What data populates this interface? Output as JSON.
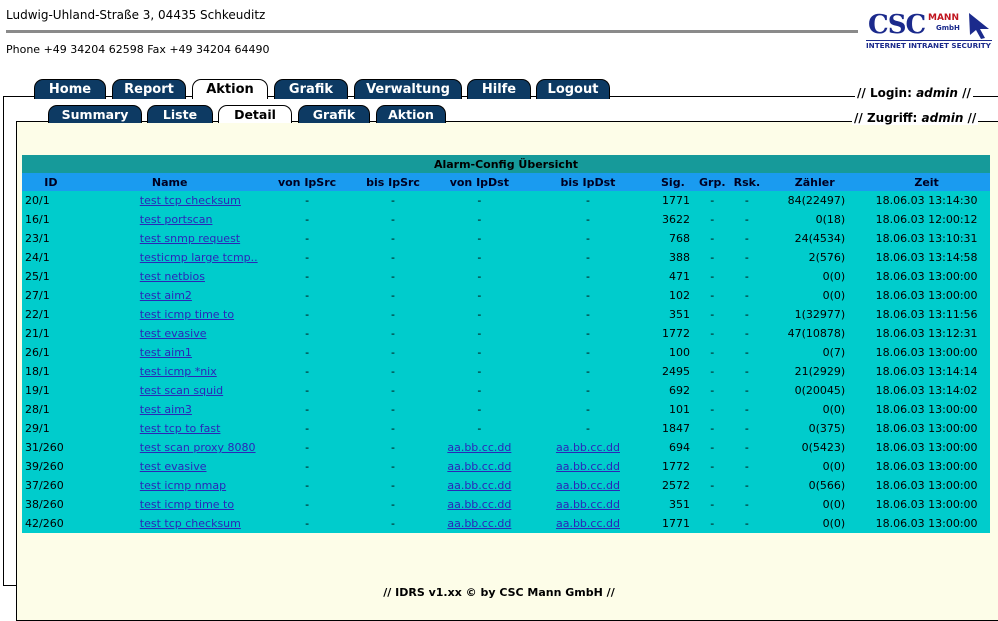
{
  "header": {
    "address": "Ludwig-Uhland-Straße 3, 04435 Schkeuditz",
    "phone": "Phone +49 34204 62598 Fax +49 34204 64490",
    "logo": {
      "csc": "CSC",
      "mann": "MANN",
      "gmbh": "GmbH",
      "tagline": "INTERNET INTRANET SECURITY"
    }
  },
  "main_tabs": [
    {
      "label": "Home"
    },
    {
      "label": "Report"
    },
    {
      "label": "Aktion"
    },
    {
      "label": "Grafik"
    },
    {
      "label": "Verwaltung"
    },
    {
      "label": "Hilfe"
    },
    {
      "label": "Logout"
    }
  ],
  "sub_tabs": [
    {
      "label": "Summary"
    },
    {
      "label": "Liste"
    },
    {
      "label": "Detail"
    },
    {
      "label": "Grafik"
    },
    {
      "label": "Aktion"
    }
  ],
  "login": {
    "prefix": "// Login: ",
    "user": "admin",
    "suffix": " //"
  },
  "zugriff": {
    "prefix": "// Zugriff: ",
    "user": "admin",
    "suffix": " //"
  },
  "table": {
    "caption": "Alarm-Config Übersicht",
    "columns": [
      "ID",
      "Name",
      "von IpSrc",
      "bis IpSrc",
      "von IpDst",
      "bis IpDst",
      "Sig.",
      "Grp.",
      "Rsk.",
      "Zähler",
      "Zeit"
    ],
    "rows": [
      [
        "20/1",
        "test tcp checksum",
        "-",
        "-",
        "-",
        "-",
        "1771",
        "-",
        "-",
        "84(22497)",
        "18.06.03 13:14:30"
      ],
      [
        "16/1",
        "test portscan",
        "-",
        "-",
        "-",
        "-",
        "3622",
        "-",
        "-",
        "0(18)",
        "18.06.03 12:00:12"
      ],
      [
        "23/1",
        "test snmp request",
        "-",
        "-",
        "-",
        "-",
        "768",
        "-",
        "-",
        "24(4534)",
        "18.06.03 13:10:31"
      ],
      [
        "24/1",
        "testicmp large tcmp..",
        "-",
        "-",
        "-",
        "-",
        "388",
        "-",
        "-",
        "2(576)",
        "18.06.03 13:14:58"
      ],
      [
        "25/1",
        "test netbios",
        "-",
        "-",
        "-",
        "-",
        "471",
        "-",
        "-",
        "0(0)",
        "18.06.03 13:00:00"
      ],
      [
        "27/1",
        "test aim2",
        "-",
        "-",
        "-",
        "-",
        "102",
        "-",
        "-",
        "0(0)",
        "18.06.03 13:00:00"
      ],
      [
        "22/1",
        "test icmp time to",
        "-",
        "-",
        "-",
        "-",
        "351",
        "-",
        "-",
        "1(32977)",
        "18.06.03 13:11:56"
      ],
      [
        "21/1",
        "test evasive",
        "-",
        "-",
        "-",
        "-",
        "1772",
        "-",
        "-",
        "47(10878)",
        "18.06.03 13:12:31"
      ],
      [
        "26/1",
        "test aim1",
        "-",
        "-",
        "-",
        "-",
        "100",
        "-",
        "-",
        "0(7)",
        "18.06.03 13:00:00"
      ],
      [
        "18/1",
        "test icmp *nix",
        "-",
        "-",
        "-",
        "-",
        "2495",
        "-",
        "-",
        "21(2929)",
        "18.06.03 13:14:14"
      ],
      [
        "19/1",
        "test scan squid",
        "-",
        "-",
        "-",
        "-",
        "692",
        "-",
        "-",
        "0(20045)",
        "18.06.03 13:14:02"
      ],
      [
        "28/1",
        "test aim3",
        "-",
        "-",
        "-",
        "-",
        "101",
        "-",
        "-",
        "0(0)",
        "18.06.03 13:00:00"
      ],
      [
        "29/1",
        "test tcp to fast",
        "-",
        "-",
        "-",
        "-",
        "1847",
        "-",
        "-",
        "0(375)",
        "18.06.03 13:00:00"
      ],
      [
        "31/260",
        "test scan proxy 8080",
        "-",
        "-",
        "aa.bb.cc.dd",
        "aa.bb.cc.dd",
        "694",
        "-",
        "-",
        "0(5423)",
        "18.06.03 13:00:00"
      ],
      [
        "39/260",
        "test evasive",
        "-",
        "-",
        "aa.bb.cc.dd",
        "aa.bb.cc.dd",
        "1772",
        "-",
        "-",
        "0(0)",
        "18.06.03 13:00:00"
      ],
      [
        "37/260",
        "test icmp nmap",
        "-",
        "-",
        "aa.bb.cc.dd",
        "aa.bb.cc.dd",
        "2572",
        "-",
        "-",
        "0(566)",
        "18.06.03 13:00:00"
      ],
      [
        "38/260",
        "test icmp time to",
        "-",
        "-",
        "aa.bb.cc.dd",
        "aa.bb.cc.dd",
        "351",
        "-",
        "-",
        "0(0)",
        "18.06.03 13:00:00"
      ],
      [
        "42/260",
        "test tcp checksum",
        "-",
        "-",
        "aa.bb.cc.dd",
        "aa.bb.cc.dd",
        "1771",
        "-",
        "-",
        "0(0)",
        "18.06.03 13:00:00"
      ]
    ]
  },
  "footer": "//  IDRS v1.xx © by CSC Mann GmbH    //",
  "colors": {
    "tab_bg": "#0d3a63",
    "caption_bg": "#169a9a",
    "header_bg": "#1a9bf0",
    "row_bg": "#00cccc",
    "link": "#2a27b8",
    "panel_bg": "#fdfde8"
  }
}
